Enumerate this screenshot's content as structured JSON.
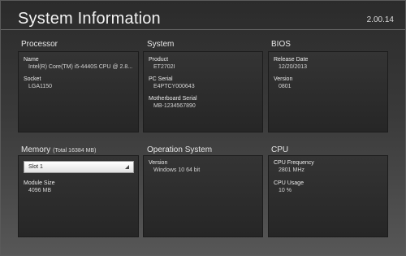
{
  "window": {
    "title": "System Information",
    "version": "2.00.14"
  },
  "processor": {
    "heading": "Processor",
    "name_label": "Name",
    "name_value": "Intel(R) Core(TM) i5-4440S CPU @ 2.8...",
    "socket_label": "Socket",
    "socket_value": "LGA1150"
  },
  "system": {
    "heading": "System",
    "product_label": "Product",
    "product_value": "ET2702I",
    "pc_serial_label": "PC Serial",
    "pc_serial_value": "E4PTCY000643",
    "mb_serial_label": "Motherboard Serial",
    "mb_serial_value": "MB-1234567890"
  },
  "bios": {
    "heading": "BIOS",
    "release_label": "Release Date",
    "release_value": "12/20/2013",
    "version_label": "Version",
    "version_value": "0801"
  },
  "memory": {
    "heading": "Memory",
    "total": "(Total 16384 MB)",
    "slot_selected": "Slot 1",
    "module_label": "Module Size",
    "module_value": "4096 MB"
  },
  "os": {
    "heading": "Operation System",
    "version_label": "Version",
    "version_value": "Windows 10 64 bit"
  },
  "cpu": {
    "heading": "CPU",
    "freq_label": "CPU Frequency",
    "freq_value": "2801 MHz",
    "usage_label": "CPU Usage",
    "usage_value": "10 %"
  },
  "colors": {
    "background_top": "#2b2b2b",
    "background_bottom": "#575757",
    "panel": "#2e2e2e",
    "text": "#e6e6e6"
  },
  "icons": {
    "dropdown": "chevron-down-icon"
  }
}
